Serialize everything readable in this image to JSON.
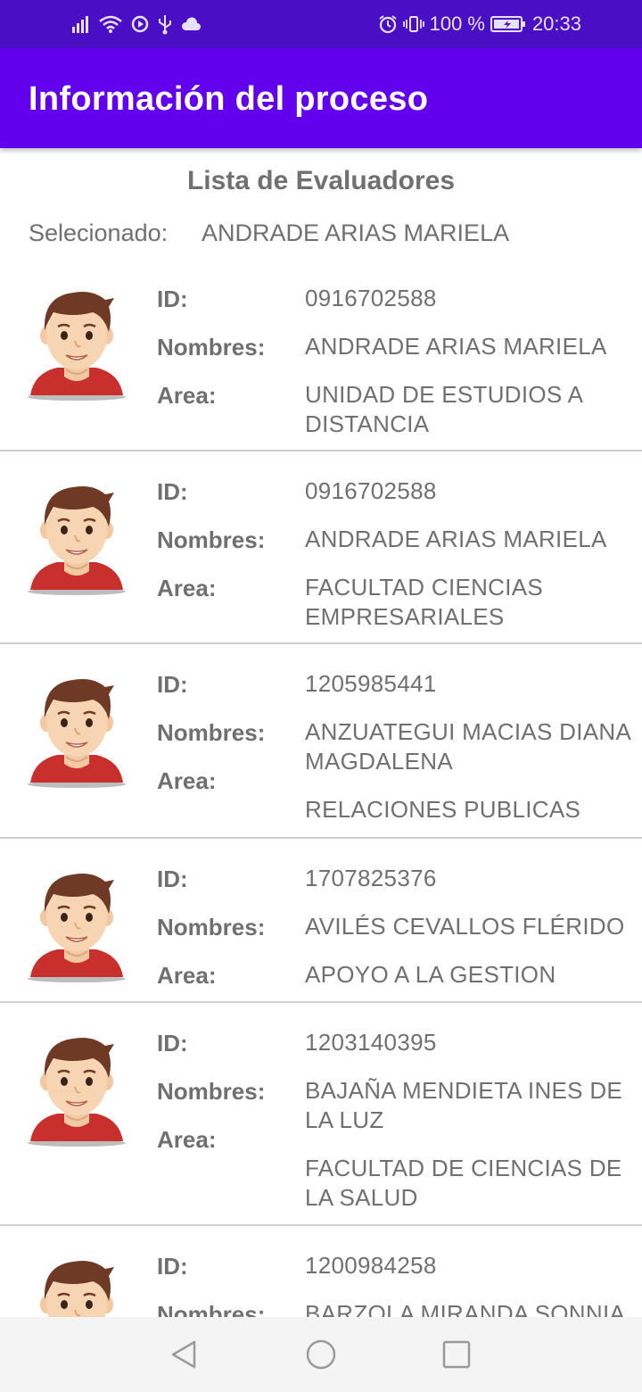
{
  "status_bar": {
    "battery": "100 %",
    "time": "20:33",
    "icons_left": [
      "signal-icon",
      "wifi-icon",
      "record-icon",
      "usb-icon",
      "cloud-icon"
    ],
    "icons_right": [
      "alarm-icon",
      "vibrate-icon",
      "battery-icon"
    ]
  },
  "app_bar": {
    "title": "Información del proceso"
  },
  "list": {
    "title": "Lista de Evaluadores",
    "selected_label": "Selecionado:",
    "selected_value": "ANDRADE ARIAS MARIELA",
    "labels": {
      "id": "ID:",
      "names": "Nombres:",
      "area": "Area:"
    },
    "items": [
      {
        "id": "0916702588",
        "names": "ANDRADE ARIAS MARIELA",
        "area": "UNIDAD DE ESTUDIOS A DISTANCIA"
      },
      {
        "id": "0916702588",
        "names": "ANDRADE ARIAS MARIELA",
        "area": "FACULTAD CIENCIAS EMPRESARIALES"
      },
      {
        "id": "1205985441",
        "names": "ANZUATEGUI MACIAS DIANA MAGDALENA",
        "area": "RELACIONES PUBLICAS"
      },
      {
        "id": "1707825376",
        "names": "AVILÉS CEVALLOS FLÉRIDO",
        "area": "APOYO A LA GESTION"
      },
      {
        "id": "1203140395",
        "names": "BAJAÑA MENDIETA INES DE LA LUZ",
        "area": "FACULTAD DE CIENCIAS DE LA SALUD"
      },
      {
        "id": "1200984258",
        "names": "BARZOLA MIRANDA SONNIA",
        "area": ""
      }
    ]
  },
  "colors": {
    "status_bar": "#4a0fc4",
    "app_bar": "#6200ee",
    "text": "#707070"
  }
}
